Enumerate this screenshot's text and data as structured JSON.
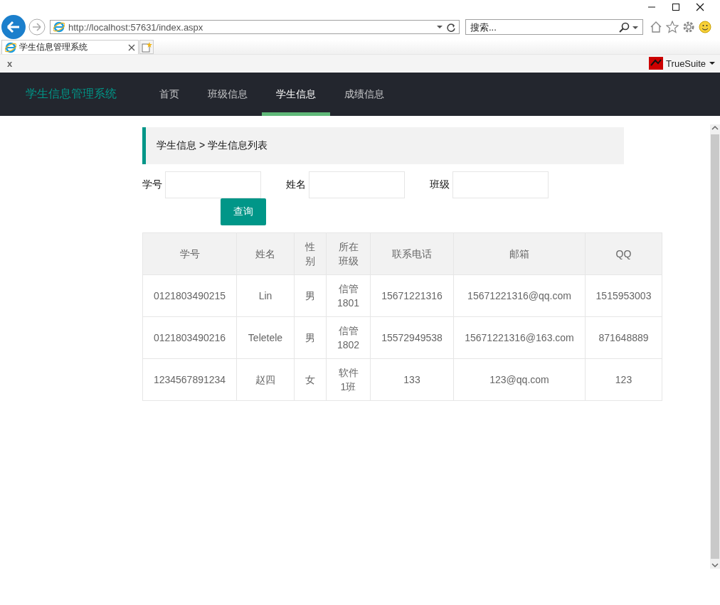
{
  "browser": {
    "address": "http://localhost:57631/index.aspx",
    "search_placeholder": "搜索...",
    "tab_title": "学生信息管理系统",
    "toolbar_close": "x",
    "addon": "TrueSuite"
  },
  "nav": {
    "brand": "学生信息管理系统",
    "items": [
      {
        "label": "首页",
        "selected": false
      },
      {
        "label": "班级信息",
        "selected": false
      },
      {
        "label": "学生信息",
        "selected": true
      },
      {
        "label": "成绩信息",
        "selected": false
      }
    ]
  },
  "breadcrumb": "学生信息 > 学生信息列表",
  "filters": [
    {
      "label": "学号"
    },
    {
      "label": "姓名"
    },
    {
      "label": "班级"
    }
  ],
  "search_button": "查询",
  "table": {
    "columns": [
      "学号",
      "姓名",
      "性别",
      "所在班级",
      "联系电话",
      "邮箱",
      "QQ"
    ],
    "rows": [
      [
        "0121803490215",
        "Lin",
        "男",
        "信管1801",
        "15671221316",
        "15671221316@qq.com",
        "1515953003"
      ],
      [
        "0121803490216",
        "Teletele",
        "男",
        "信管1802",
        "15572949538",
        "15671221316@163.com",
        "871648889"
      ],
      [
        "1234567891234",
        "赵四",
        "女",
        "软件1班",
        "133",
        "123@qq.com",
        "123"
      ]
    ]
  }
}
